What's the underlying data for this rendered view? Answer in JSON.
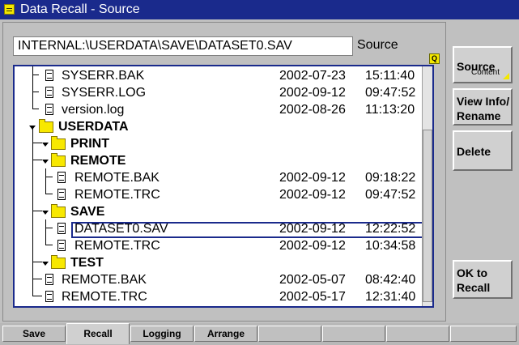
{
  "window": {
    "title": "Data Recall - Source"
  },
  "path": {
    "value": "INTERNAL:\\USERDATA\\SAVE\\DATASET0.SAV",
    "label": "Source"
  },
  "tree": {
    "rows": [
      {
        "name": "SYSERR.BAK",
        "type": "file",
        "date": "2002-07-23",
        "time": "15:11:40"
      },
      {
        "name": "SYSERR.LOG",
        "type": "file",
        "date": "2002-09-12",
        "time": "09:47:52"
      },
      {
        "name": "version.log",
        "type": "file",
        "date": "2002-08-26",
        "time": "11:13:20"
      },
      {
        "name": "USERDATA",
        "type": "folder"
      },
      {
        "name": "PRINT",
        "type": "folder"
      },
      {
        "name": "REMOTE",
        "type": "folder"
      },
      {
        "name": "REMOTE.BAK",
        "type": "file",
        "date": "2002-09-12",
        "time": "09:18:22"
      },
      {
        "name": "REMOTE.TRC",
        "type": "file",
        "date": "2002-09-12",
        "time": "09:47:52"
      },
      {
        "name": "SAVE",
        "type": "folder"
      },
      {
        "name": "DATASET0.SAV",
        "type": "file",
        "date": "2002-09-12",
        "time": "12:22:52",
        "selected": true
      },
      {
        "name": "REMOTE.TRC",
        "type": "file",
        "date": "2002-09-12",
        "time": "10:34:58"
      },
      {
        "name": "TEST",
        "type": "folder"
      },
      {
        "name": "REMOTE.BAK",
        "type": "file",
        "date": "2002-05-07",
        "time": "08:42:40"
      },
      {
        "name": "REMOTE.TRC",
        "type": "file",
        "date": "2002-05-17",
        "time": "12:31:40"
      }
    ]
  },
  "marker": {
    "label": "Q"
  },
  "softkeys": {
    "source": {
      "label": "Source",
      "sub": "Content"
    },
    "view_info": {
      "label": "View Info/ Rename"
    },
    "delete": {
      "label": "Delete"
    },
    "ok_recall": {
      "label": "OK to Recall"
    }
  },
  "tabs": [
    {
      "label": "Save"
    },
    {
      "label": "Recall",
      "active": true
    },
    {
      "label": "Logging"
    },
    {
      "label": "Arrange"
    },
    {
      "label": ""
    },
    {
      "label": ""
    },
    {
      "label": ""
    },
    {
      "label": ""
    }
  ]
}
